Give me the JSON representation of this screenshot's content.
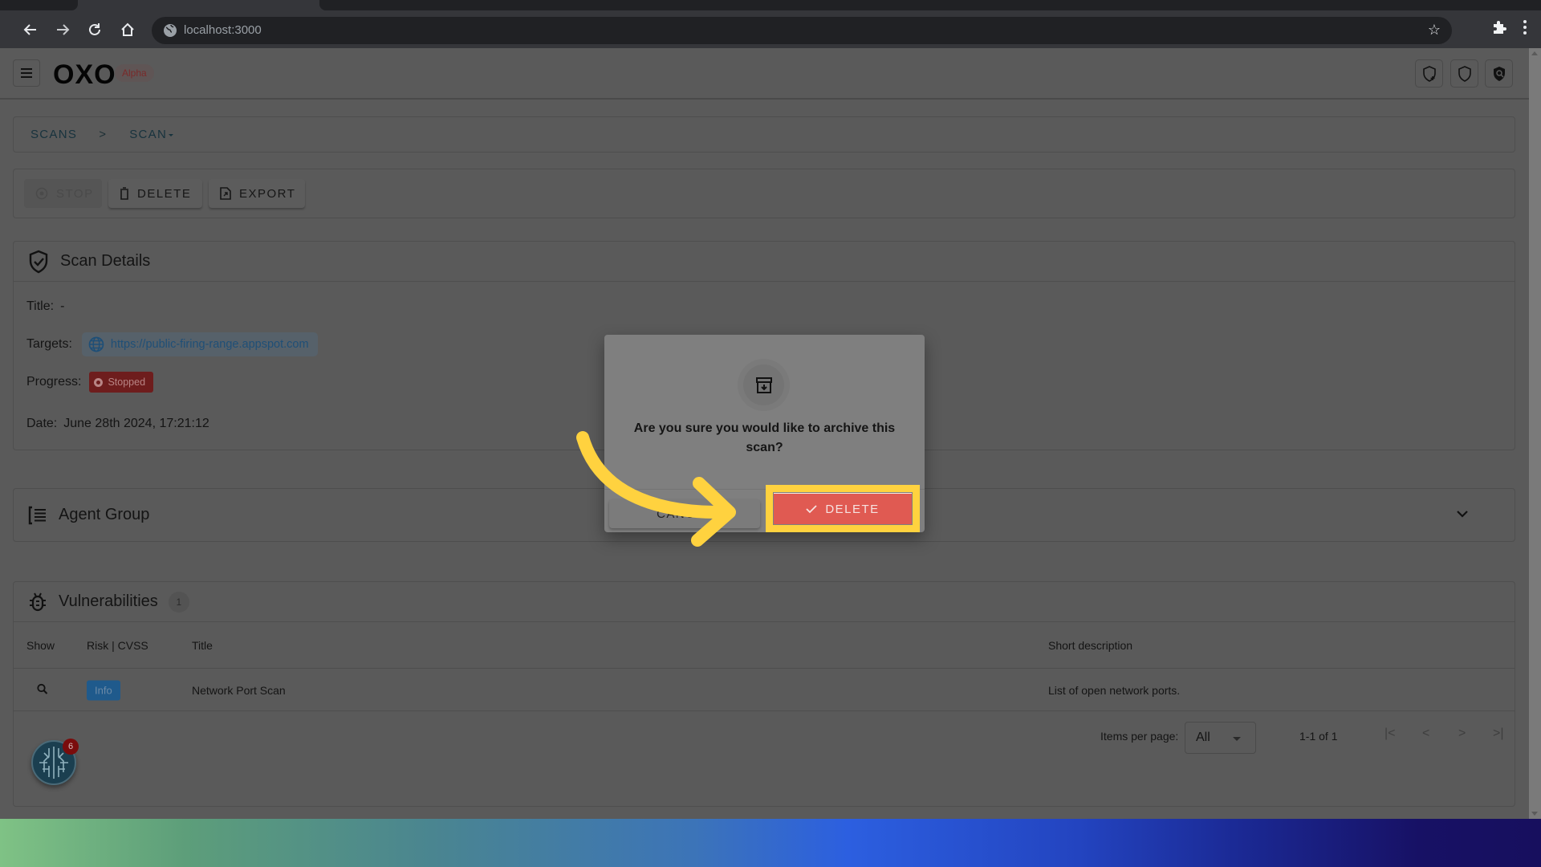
{
  "browser": {
    "url": "localhost:3000",
    "icons": [
      "back-icon",
      "forward-icon",
      "reload-icon",
      "home-icon",
      "site-info-icon",
      "bookmark-star-icon",
      "extensions-icon",
      "menu-kebab-icon"
    ]
  },
  "header": {
    "logo": "OXO",
    "badge": "Alpha",
    "icons": [
      "shield-add-icon",
      "shield-icon",
      "shield-search-icon"
    ]
  },
  "breadcrumb": {
    "items": [
      "SCANS",
      "SCAN"
    ],
    "separator": ">"
  },
  "toolbar": {
    "stop_label": "STOP",
    "delete_label": "DELETE",
    "export_label": "EXPORT"
  },
  "scan_details": {
    "heading": "Scan Details",
    "title_label": "Title:",
    "title_value": "-",
    "targets_label": "Targets:",
    "target_url": "https://public-firing-range.appspot.com",
    "progress_label": "Progress:",
    "progress_status": "Stopped",
    "date_label": "Date:",
    "date_value": "June 28th 2024, 17:21:12"
  },
  "agent_group": {
    "heading": "Agent Group"
  },
  "vulnerabilities": {
    "heading": "Vulnerabilities",
    "count": "1",
    "columns": [
      "Show",
      "Risk | CVSS",
      "Title",
      "Short description"
    ],
    "rows": [
      {
        "risk": "Info",
        "title": "Network Port Scan",
        "description": "List of open network ports."
      }
    ],
    "pagination": {
      "items_per_page_label": "Items per page:",
      "items_per_page_value": "All",
      "range": "1-1 of 1"
    }
  },
  "fab": {
    "notification_count": "6"
  },
  "dialog": {
    "message": "Are you sure you would like to archive this scan?",
    "cancel_label": "CANCEL",
    "confirm_label": "DELETE"
  },
  "colors": {
    "highlight": "#ffd23f",
    "delete_button": "#e05a52",
    "stopped_badge": "#6e1d1d",
    "info_badge": "#1f5a8c"
  }
}
